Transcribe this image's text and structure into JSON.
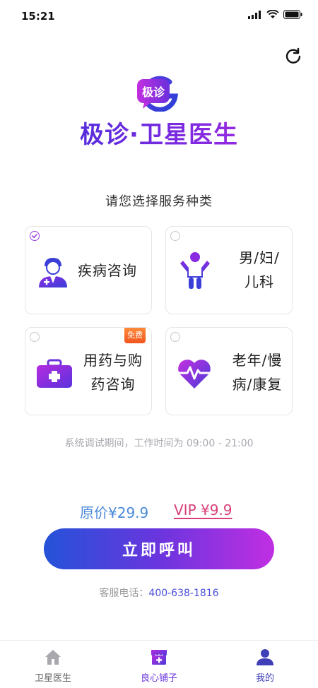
{
  "status_bar": {
    "time": "15:21"
  },
  "header": {
    "logo_text": "极诊",
    "title": "极诊·卫星医生",
    "subtitle": "请您选择服务种类"
  },
  "services": [
    {
      "line1": "疾病咨询",
      "line2": "",
      "icon": "doctor-icon",
      "selected": true
    },
    {
      "line1": "男/妇/",
      "line2": "儿科",
      "icon": "child-icon",
      "selected": false
    },
    {
      "line1": "用药与购",
      "line2": "药咨询",
      "icon": "medkit-icon",
      "selected": false,
      "badge": "免费"
    },
    {
      "line1": "老年/慢",
      "line2": "病/康复",
      "icon": "heart-icon",
      "selected": false
    }
  ],
  "notice": "系统调试期间，工作时间为 09:00 - 21:00",
  "pricing": {
    "original": "原价¥29.9",
    "vip": "VIP ¥9.9"
  },
  "call_button": "立即呼叫",
  "hotline": {
    "label": "客服电话：",
    "number": "400-638-1816"
  },
  "tabbar": [
    {
      "label": "卫星医生",
      "icon": "home-icon",
      "color": "#666666"
    },
    {
      "label": "良心铺子",
      "icon": "shop-icon",
      "color": "#6a35de"
    },
    {
      "label": "我的",
      "icon": "user-icon",
      "color": "#3f3fb8"
    }
  ],
  "colors": {
    "accent_start": "#2453d8",
    "accent_end": "#c02fe2",
    "vip": "#d9407a",
    "original_price": "#4a8ad8"
  }
}
